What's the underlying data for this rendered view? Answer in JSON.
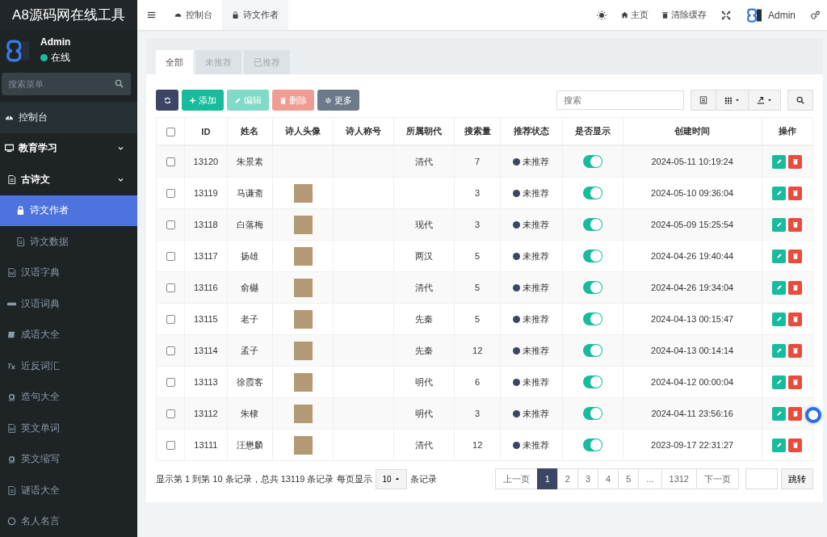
{
  "app": {
    "title": "A8源码网在线工具"
  },
  "user": {
    "name": "Admin",
    "status": "在线",
    "online": true
  },
  "sidebar": {
    "search_placeholder": "搜索菜单",
    "items": [
      {
        "label": "控制台",
        "selected": false
      },
      {
        "label": "教育学习",
        "selected": false,
        "expanded": true,
        "children": [
          {
            "label": "古诗文",
            "selected": false,
            "expanded": true,
            "children": [
              {
                "label": "诗文作者",
                "selected": true
              },
              {
                "label": "诗文数据",
                "selected": false
              }
            ]
          },
          {
            "label": "汉语字典",
            "selected": false
          },
          {
            "label": "汉语词典",
            "selected": false
          },
          {
            "label": "成语大全",
            "selected": false
          },
          {
            "label": "近反词汇",
            "selected": false
          },
          {
            "label": "造句大全",
            "selected": false
          },
          {
            "label": "英文单词",
            "selected": false
          },
          {
            "label": "英文缩写",
            "selected": false
          },
          {
            "label": "谜语大全",
            "selected": false
          },
          {
            "label": "名人名言",
            "selected": false
          }
        ]
      }
    ]
  },
  "header": {
    "tabs": [
      {
        "label": "控制台",
        "selected": false
      },
      {
        "label": "诗文作者",
        "selected": true
      }
    ],
    "links": [
      "主页",
      "清除缓存"
    ],
    "user_name": "Admin"
  },
  "filter_tabs": [
    {
      "label": "全部",
      "selected": true
    },
    {
      "label": "未推荐",
      "selected": false
    },
    {
      "label": "已推荐",
      "selected": false
    }
  ],
  "toolbar": {
    "buttons": [
      {
        "label": "添加",
        "disabled": false
      },
      {
        "label": "编辑",
        "disabled": true
      },
      {
        "label": "删除",
        "disabled": true
      },
      {
        "label": "更多",
        "disabled": false
      }
    ],
    "search_placeholder": "搜索"
  },
  "table": {
    "select_all_checked": false,
    "columns": [
      "ID",
      "姓名",
      "诗人头像",
      "诗人称号",
      "所属朝代",
      "搜索量",
      "推荐状态",
      "是否显示",
      "创建时间",
      "操作"
    ],
    "rows": [
      {
        "checked": false,
        "id": "13120",
        "name": "朱景素",
        "avatar": false,
        "dynasty": "清代",
        "searches": "7",
        "status": "未推荐",
        "shown": true,
        "created": "2024-05-11 10:19:24"
      },
      {
        "checked": false,
        "id": "13119",
        "name": "马谦斋",
        "avatar": true,
        "dynasty": "",
        "searches": "3",
        "status": "未推荐",
        "shown": true,
        "created": "2024-05-10 09:36:04"
      },
      {
        "checked": false,
        "id": "13118",
        "name": "白落梅",
        "avatar": true,
        "dynasty": "现代",
        "searches": "3",
        "status": "未推荐",
        "shown": true,
        "created": "2024-05-09 15:25:54"
      },
      {
        "checked": false,
        "id": "13117",
        "name": "扬雄",
        "avatar": true,
        "dynasty": "两汉",
        "searches": "5",
        "status": "未推荐",
        "shown": true,
        "created": "2024-04-26 19:40:44"
      },
      {
        "checked": false,
        "id": "13116",
        "name": "俞樾",
        "avatar": true,
        "dynasty": "清代",
        "searches": "5",
        "status": "未推荐",
        "shown": true,
        "created": "2024-04-26 19:34:04"
      },
      {
        "checked": false,
        "id": "13115",
        "name": "老子",
        "avatar": true,
        "dynasty": "先秦",
        "searches": "5",
        "status": "未推荐",
        "shown": true,
        "created": "2024-04-13 00:15:47"
      },
      {
        "checked": false,
        "id": "13114",
        "name": "孟子",
        "avatar": true,
        "dynasty": "先秦",
        "searches": "12",
        "status": "未推荐",
        "shown": true,
        "created": "2024-04-13 00:14:14"
      },
      {
        "checked": false,
        "id": "13113",
        "name": "徐霞客",
        "avatar": true,
        "dynasty": "明代",
        "searches": "6",
        "status": "未推荐",
        "shown": true,
        "created": "2024-04-12 00:00:04"
      },
      {
        "checked": false,
        "id": "13112",
        "name": "朱棣",
        "avatar": true,
        "dynasty": "明代",
        "searches": "3",
        "status": "未推荐",
        "shown": true,
        "created": "2024-04-11 23:56:16"
      },
      {
        "checked": false,
        "id": "13111",
        "name": "汪懋麟",
        "avatar": true,
        "dynasty": "清代",
        "searches": "12",
        "status": "未推荐",
        "shown": true,
        "created": "2023-09-17 22:31:27"
      }
    ]
  },
  "footer": {
    "info": "显示第 1 到第 10 条记录，总共 13119 条记录 每页显示",
    "page_size": "10",
    "suffix": "条记录",
    "prev": "上一页",
    "pages": [
      {
        "label": "1",
        "selected": true
      },
      {
        "label": "2",
        "selected": false
      },
      {
        "label": "3",
        "selected": false
      },
      {
        "label": "4",
        "selected": false
      },
      {
        "label": "5",
        "selected": false
      },
      {
        "label": "...",
        "selected": false
      },
      {
        "label": "1312",
        "selected": false
      }
    ],
    "next": "下一页",
    "jump": "跳转"
  }
}
